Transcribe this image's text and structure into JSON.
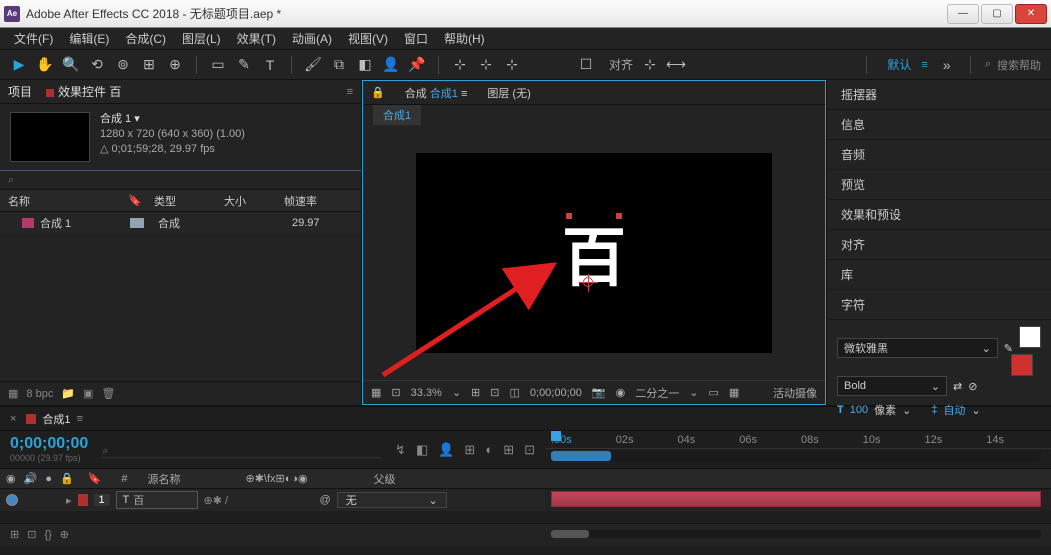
{
  "titlebar": {
    "icon": "Ae",
    "text": "Adobe After Effects CC 2018 - 无标题项目.aep *"
  },
  "menu": {
    "file": "文件(F)",
    "edit": "编辑(E)",
    "comp": "合成(C)",
    "layer": "图层(L)",
    "effect": "效果(T)",
    "anim": "动画(A)",
    "view": "视图(V)",
    "window": "窗口",
    "help": "帮助(H)"
  },
  "toolbar": {
    "align": "对齐",
    "default": "默认",
    "search_help": "搜索帮助"
  },
  "project": {
    "tab_project": "项目",
    "tab_fx": "效果控件 百",
    "comp_name": "合成 1",
    "comp_res": "1280 x 720  (640 x 360) (1.00)",
    "comp_dur": "△ 0;01;59;28, 29.97 fps",
    "col_name": "名称",
    "col_type": "类型",
    "col_size": "大小",
    "col_fps": "帧速率",
    "item_name": "合成 1",
    "item_type": "合成",
    "item_fps": "29.97",
    "bpc": "8 bpc"
  },
  "comp": {
    "tab_label_a": "合成",
    "tab_label_b": "合成1",
    "layer_label": "图层  (无)",
    "crumb": "合成1",
    "text_char": "百",
    "zoom": "33.3%",
    "time": "0;00;00;00",
    "res": "二分之一",
    "cam": "活动摄像"
  },
  "right": {
    "wiggler": "摇摆器",
    "info": "信息",
    "audio": "音频",
    "preview": "预览",
    "fxpresets": "效果和预设",
    "align": "对齐",
    "library": "库",
    "character": "字符",
    "font": "微软雅黑",
    "weight": "Bold",
    "size_prefix": "T",
    "size_val": "100",
    "size_unit": "像素",
    "auto": "自动"
  },
  "timeline": {
    "tab": "合成1",
    "timecode": "0;00;00;00",
    "timecode_sub": "00000 (29.97 fps)",
    "col_source": "源名称",
    "col_parent": "父级",
    "layer_idx": "1",
    "layer_t": "T",
    "layer_name": "百",
    "parent_val": "无",
    "ruler": {
      "t0": ":00s",
      "t02": "02s",
      "t04": "04s",
      "t06": "06s",
      "t08": "08s",
      "t10": "10s",
      "t12": "12s",
      "t14": "14s"
    }
  }
}
